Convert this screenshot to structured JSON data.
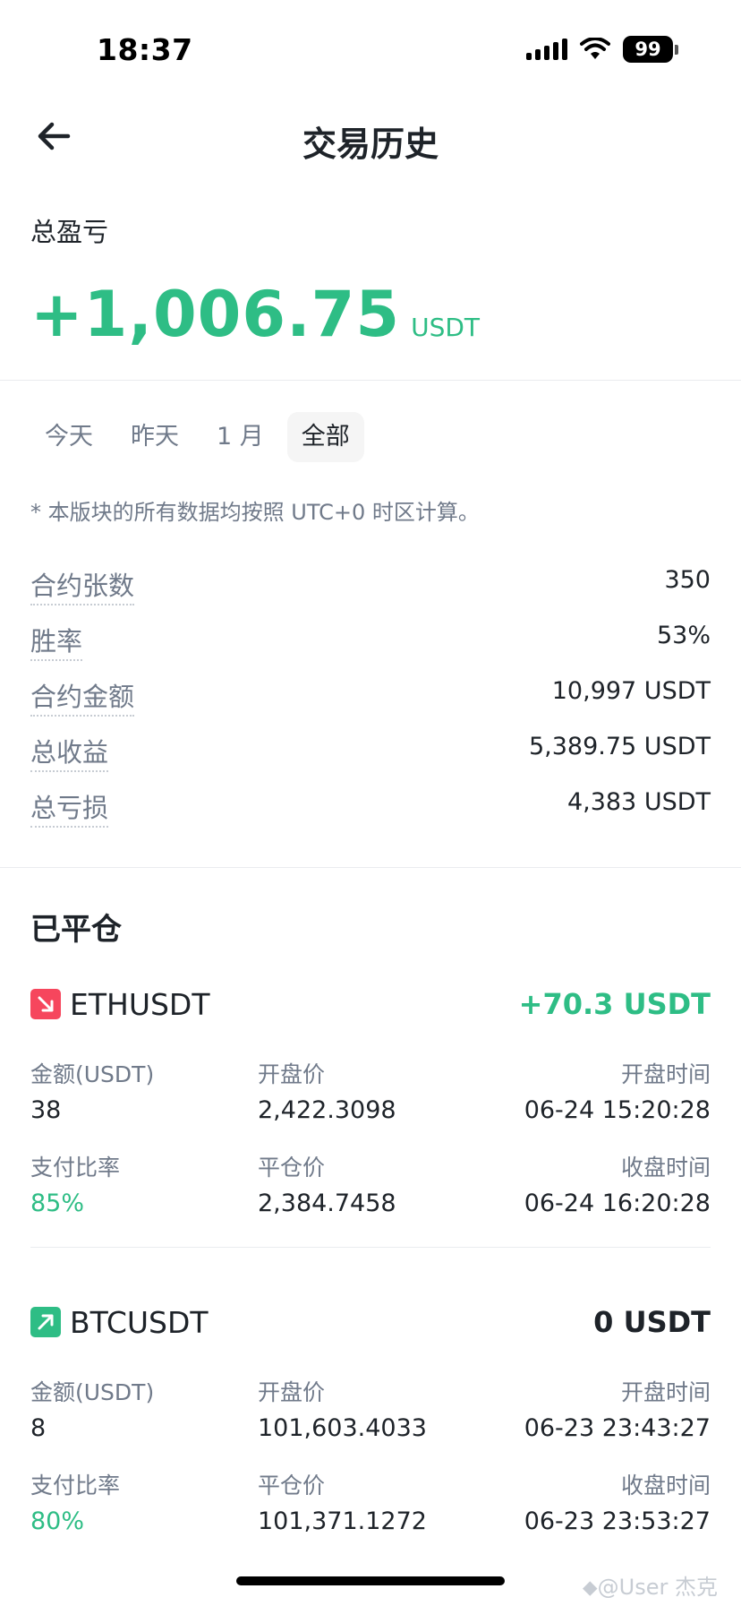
{
  "status_bar": {
    "time": "18:37",
    "battery": "99"
  },
  "header": {
    "title": "交易历史"
  },
  "summary": {
    "label": "总盈亏",
    "value": "+1,006.75",
    "unit": "USDT"
  },
  "tabs": [
    {
      "label": "今天",
      "active": false
    },
    {
      "label": "昨天",
      "active": false
    },
    {
      "label": "1 月",
      "active": false
    },
    {
      "label": "全部",
      "active": true
    }
  ],
  "note": "* 本版块的所有数据均按照 UTC+0 时区计算。",
  "stats": [
    {
      "label": "合约张数",
      "value": "350"
    },
    {
      "label": "胜率",
      "value": "53%"
    },
    {
      "label": "合约金额",
      "value": "10,997 USDT"
    },
    {
      "label": "总收益",
      "value": "5,389.75 USDT"
    },
    {
      "label": "总亏损",
      "value": "4,383 USDT"
    }
  ],
  "closed": {
    "title": "已平仓",
    "trades": [
      {
        "symbol": "ETHUSDT",
        "direction": "down",
        "pnl": "+70.3 USDT",
        "pnl_color": "#2ebd85",
        "labels": [
          "金额(USDT)",
          "开盘价",
          "开盘时间",
          "支付比率",
          "平仓价",
          "收盘时间"
        ],
        "amount": "38",
        "open_price": "2,422.3098",
        "open_time": "06-24 15:20:28",
        "pay_ratio": "85%",
        "close_price": "2,384.7458",
        "close_time": "06-24 16:20:28"
      },
      {
        "symbol": "BTCUSDT",
        "direction": "up",
        "pnl": "0 USDT",
        "pnl_color": "#1e2329",
        "labels": [
          "金额(USDT)",
          "开盘价",
          "开盘时间",
          "支付比率",
          "平仓价",
          "收盘时间"
        ],
        "amount": "8",
        "open_price": "101,603.4033",
        "open_time": "06-23 23:43:27",
        "pay_ratio": "80%",
        "close_price": "101,371.1272",
        "close_time": "06-23 23:53:27"
      }
    ]
  },
  "watermark": "⬥@User 杰克",
  "colors": {
    "up": "#2ebd85",
    "down": "#f6465d",
    "text": "#1e2329",
    "muted": "#707a8a"
  }
}
